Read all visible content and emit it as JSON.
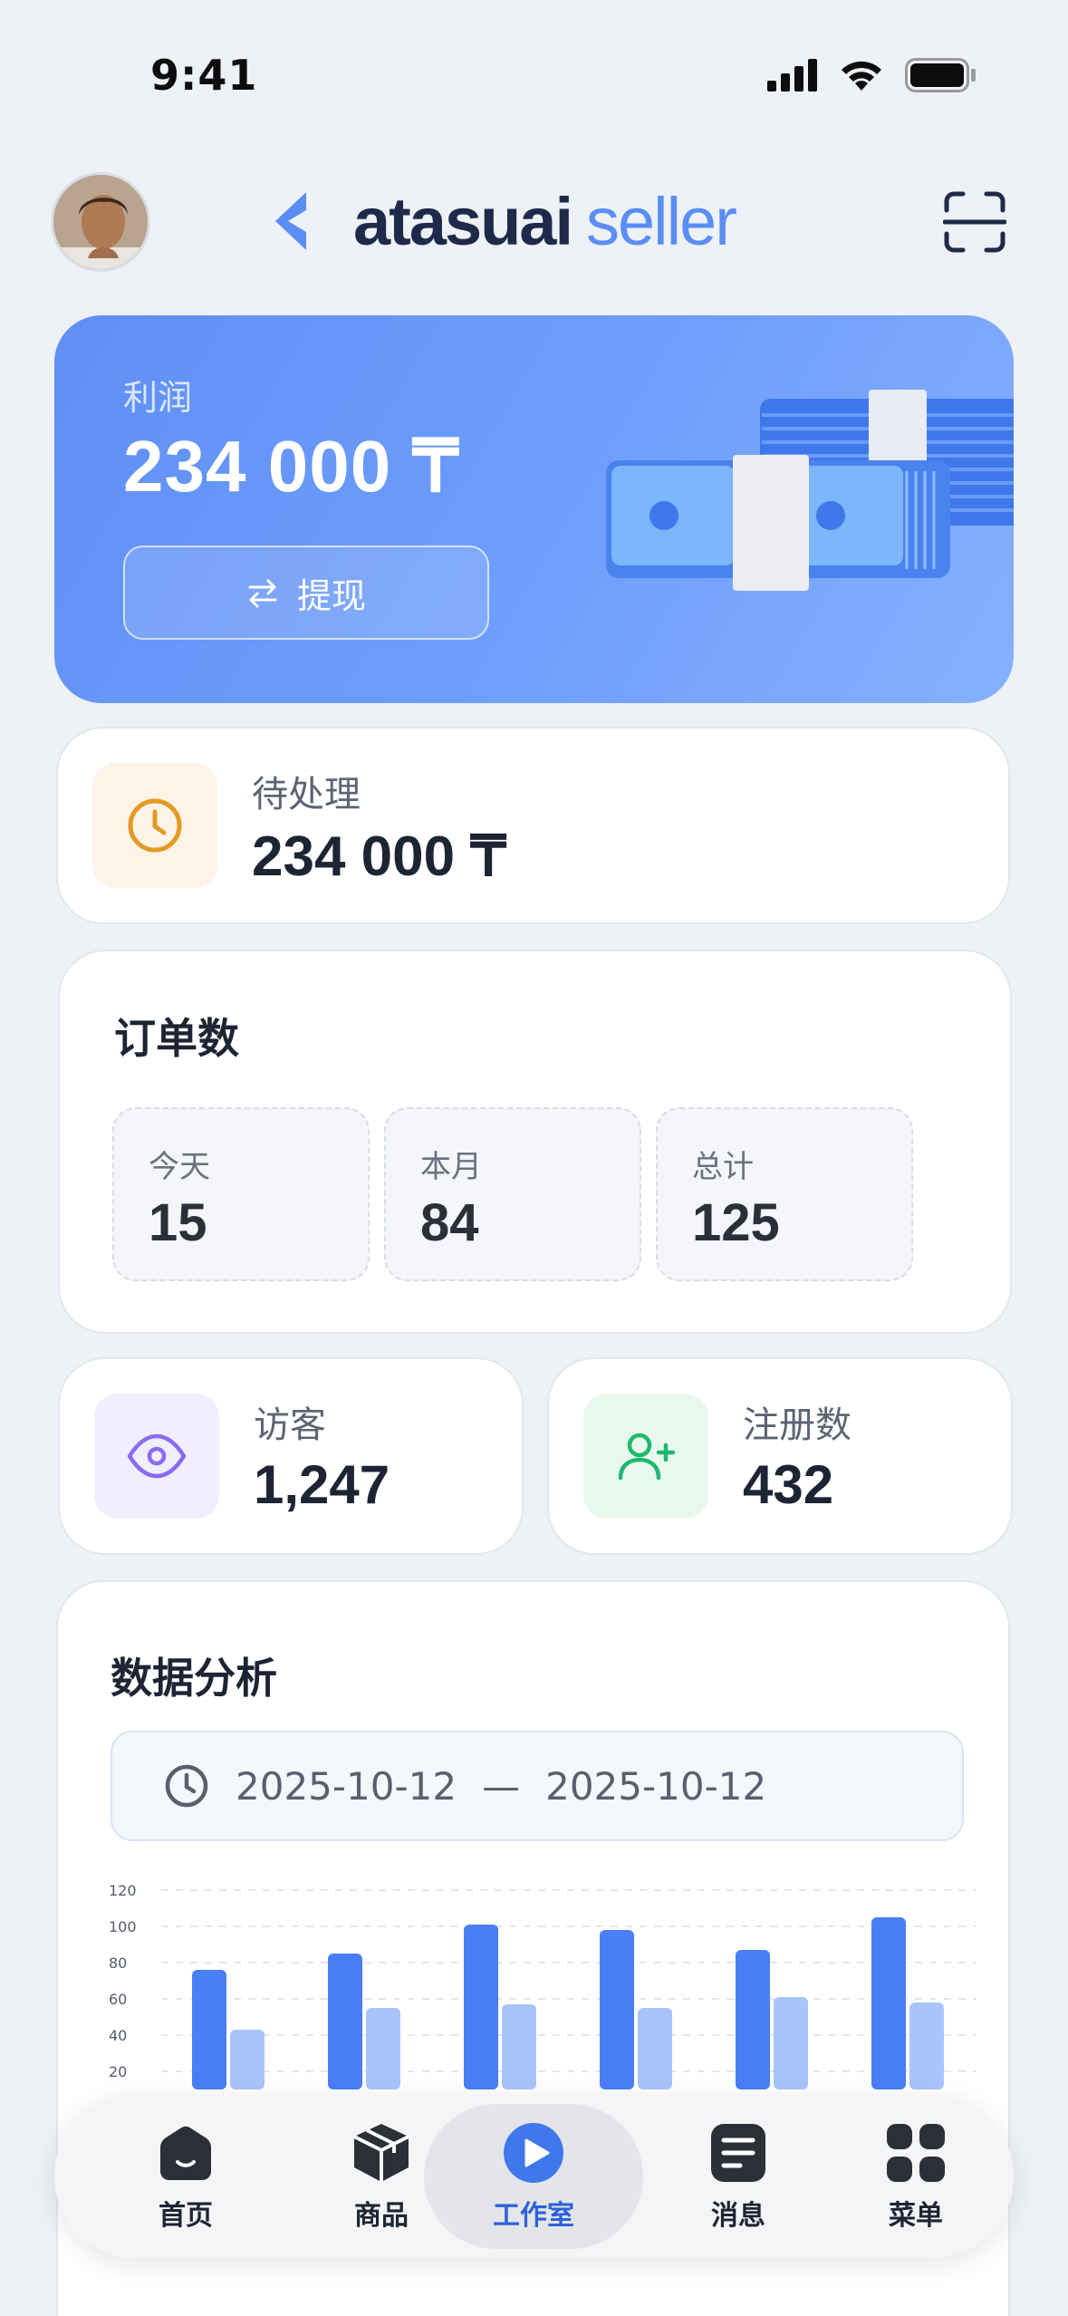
{
  "status_bar": {
    "time": "9:41"
  },
  "header": {
    "logo_brand": "atasuai",
    "logo_suffix": "seller"
  },
  "profit": {
    "label": "利润",
    "value": "234 000 ₸",
    "withdraw_label": "提现"
  },
  "pending": {
    "label": "待处理",
    "value": "234 000 ₸"
  },
  "orders": {
    "title": "订单数",
    "stats": [
      {
        "label": "今天",
        "value": "15"
      },
      {
        "label": "本月",
        "value": "84"
      },
      {
        "label": "总计",
        "value": "125"
      }
    ]
  },
  "visitors": {
    "label": "访客",
    "value": "1,247"
  },
  "signups": {
    "label": "注册数",
    "value": "432"
  },
  "analytics": {
    "title": "数据分析",
    "date_from": "2025-10-12",
    "date_sep": "—",
    "date_to": "2025-10-12"
  },
  "chart_data": {
    "type": "bar",
    "y_ticks": [
      "120",
      "100",
      "80",
      "60",
      "40",
      "20"
    ],
    "ylim": [
      0,
      120
    ],
    "grid": true,
    "series": [
      {
        "values": [
          76,
          85,
          101,
          98,
          87,
          105
        ],
        "color": "#4a7ef7"
      },
      {
        "values": [
          43,
          55,
          57,
          55,
          61,
          58
        ],
        "color": "#a9c4fb"
      }
    ]
  },
  "nav": {
    "items": [
      {
        "label": "首页",
        "icon": "home-icon"
      },
      {
        "label": "商品",
        "icon": "box-icon"
      },
      {
        "label": "工作室",
        "icon": "play-icon",
        "active": true
      },
      {
        "label": "消息",
        "icon": "message-icon"
      },
      {
        "label": "菜单",
        "icon": "grid-icon"
      }
    ]
  },
  "colors": {
    "accent": "#4a7ef7",
    "profit_card": "#6a9af8",
    "pending_icon": "#e39a24",
    "visitors_icon": "#8a6cf0",
    "signups_icon": "#1fb86e"
  }
}
